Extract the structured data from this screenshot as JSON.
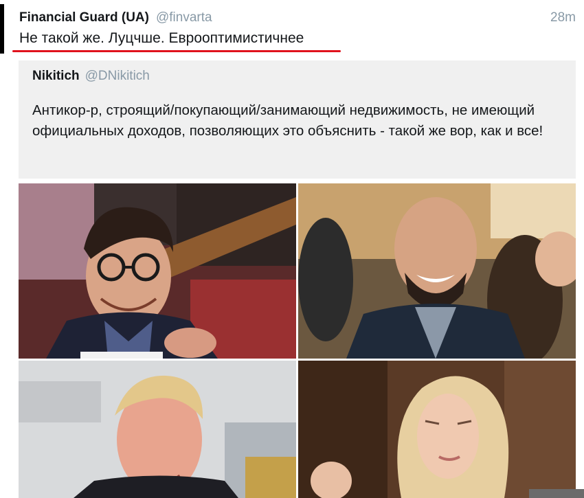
{
  "tweet": {
    "author_name": "Financial Guard (UA)",
    "author_handle": "@finvarta",
    "timestamp": "28m",
    "text": "Не такой же. Луцчше. Еврооптимистичнее"
  },
  "quoted_tweet": {
    "author_name": "Nikitich",
    "author_handle": "@DNikitich",
    "text": "Антикор-р, строящий/покупающий/занимающий недвижимость, не имеющий официальных доходов, позволяющих это объяснить - такой же вор, как и все!"
  },
  "colors": {
    "highlight_underline": "#e0121c",
    "handle_gray": "#8899a6",
    "quote_background": "#f0f0f0"
  }
}
